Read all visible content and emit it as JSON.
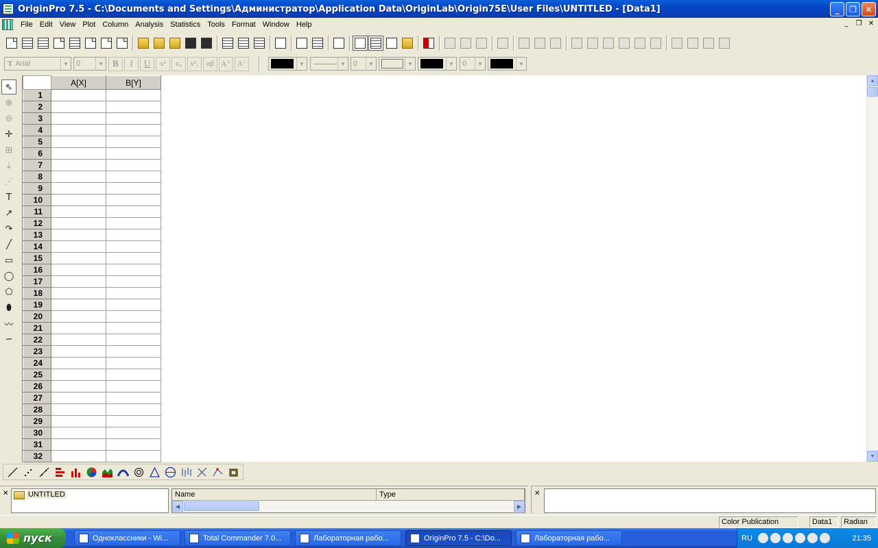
{
  "window": {
    "title": "OriginPro 7.5 - C:\\Documents and Settings\\Администратор\\Application Data\\OriginLab\\Origin75E\\User Files\\UNTITLED - [Data1]",
    "btn_minimize": "_",
    "btn_restore": "❐",
    "btn_close": "✕"
  },
  "menu": {
    "items": [
      "File",
      "Edit",
      "View",
      "Plot",
      "Column",
      "Analysis",
      "Statistics",
      "Tools",
      "Format",
      "Window",
      "Help"
    ],
    "mdi_minimize": "_",
    "mdi_restore": "❐",
    "mdi_close": "✕"
  },
  "format_toolbar": {
    "font_name": "Arial",
    "font_size": "0",
    "bold": "B",
    "italic": "I",
    "underline": "U",
    "superscript": "x²",
    "subscript": "x₂",
    "supsub": "x²₁",
    "greek": "αβ",
    "increase_font": "A⁺",
    "decrease_font": "A⁻",
    "line_width": "0",
    "pattern_size": "0",
    "colors": {
      "line_color": "#000000",
      "fill_color": "#000000",
      "pattern_color": "#000000"
    }
  },
  "left_tools": [
    {
      "icon": "pointer-icon",
      "glyph": "⇖",
      "pressed": true
    },
    {
      "icon": "zoom-in-icon",
      "glyph": "⊕",
      "disabled": true
    },
    {
      "icon": "zoom-out-icon",
      "glyph": "⊖",
      "disabled": true
    },
    {
      "icon": "screen-reader-icon",
      "glyph": "✛"
    },
    {
      "icon": "data-reader-icon",
      "glyph": "⊞",
      "disabled": true
    },
    {
      "icon": "data-selector-icon",
      "glyph": "⇣",
      "disabled": true
    },
    {
      "icon": "draw-data-icon",
      "glyph": "⋰",
      "disabled": true
    },
    {
      "icon": "text-tool-icon",
      "glyph": "T"
    },
    {
      "icon": "arrow-tool-icon",
      "glyph": "↗"
    },
    {
      "icon": "curved-arrow-icon",
      "glyph": "↷"
    },
    {
      "icon": "line-tool-icon",
      "glyph": "╱"
    },
    {
      "icon": "rectangle-tool-icon",
      "glyph": "▭"
    },
    {
      "icon": "circle-tool-icon",
      "glyph": "◯"
    },
    {
      "icon": "polygon-tool-icon",
      "glyph": "⬠"
    },
    {
      "icon": "region-tool-icon",
      "glyph": "⬮"
    },
    {
      "icon": "polyline-tool-icon",
      "glyph": "〰"
    },
    {
      "icon": "freehand-tool-icon",
      "glyph": "∽"
    }
  ],
  "worksheet": {
    "columns": [
      "A[X]",
      "B[Y]"
    ],
    "rows": [
      "1",
      "2",
      "3",
      "4",
      "5",
      "6",
      "7",
      "8",
      "9",
      "10",
      "11",
      "12",
      "13",
      "14",
      "15",
      "16",
      "17",
      "18",
      "19",
      "20",
      "21",
      "22",
      "23",
      "24",
      "25",
      "26",
      "27",
      "28",
      "29",
      "30",
      "31",
      "32"
    ]
  },
  "explorer": {
    "folder_label": "UNTITLED",
    "col_name": "Name",
    "col_type": "Type"
  },
  "status": {
    "publication": "Color Publication",
    "window_name": "Data1",
    "angle_unit": "Radian"
  },
  "taskbar": {
    "start_label": "пуск",
    "tasks": [
      {
        "label": "Одноклассники - Wi...",
        "active": false
      },
      {
        "label": "Total Commander 7.0...",
        "active": false
      },
      {
        "label": "Лабораторная рабо...",
        "active": false
      },
      {
        "label": "OriginPro 7.5 - C:\\Do...",
        "active": true
      },
      {
        "label": "Лабораторная рабо...",
        "active": false
      }
    ],
    "lang": "RU",
    "clock": "21:35"
  }
}
